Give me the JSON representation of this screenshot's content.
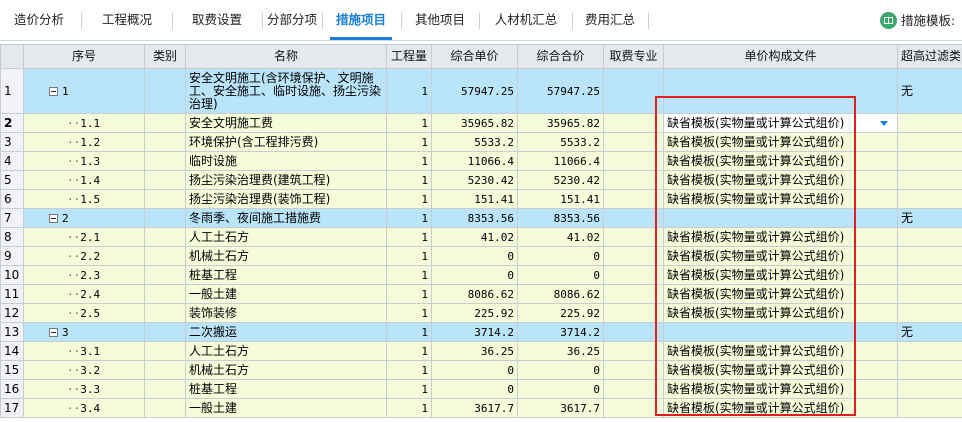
{
  "tabs": [
    {
      "label": "造价分析",
      "active": false
    },
    {
      "label": "工程概况",
      "active": false
    },
    {
      "label": "取费设置",
      "active": false
    },
    {
      "label": "分部分项",
      "active": false
    },
    {
      "label": "措施项目",
      "active": true
    },
    {
      "label": "其他项目",
      "active": false
    },
    {
      "label": "人材机汇总",
      "active": false
    },
    {
      "label": "费用汇总",
      "active": false
    }
  ],
  "template_button": {
    "label": "措施模板:",
    "icon": "template-book-icon"
  },
  "columns": [
    "",
    "序号",
    "类别",
    "名称",
    "工程量",
    "综合单价",
    "综合合价",
    "取费专业",
    "单价构成文件",
    "超高过滤类"
  ],
  "rows": [
    {
      "n": "1",
      "code": "1",
      "name": "安全文明施工(含环境保护、文明施工、安全施工、临时设施、扬尘污染治理)",
      "qty": "1",
      "price": "57947.25",
      "total": "57947.25",
      "file": "",
      "filter": "无",
      "level": "group"
    },
    {
      "n": "2",
      "code": "1.1",
      "name": "安全文明施工费",
      "qty": "1",
      "price": "35965.82",
      "total": "35965.82",
      "file": "缺省模板(实物量或计算公式组价)",
      "filter": "",
      "level": "sub",
      "active": true
    },
    {
      "n": "3",
      "code": "1.2",
      "name": "环境保护(含工程排污费)",
      "qty": "1",
      "price": "5533.2",
      "total": "5533.2",
      "file": "缺省模板(实物量或计算公式组价)",
      "filter": "",
      "level": "sub"
    },
    {
      "n": "4",
      "code": "1.3",
      "name": "临时设施",
      "qty": "1",
      "price": "11066.4",
      "total": "11066.4",
      "file": "缺省模板(实物量或计算公式组价)",
      "filter": "",
      "level": "sub"
    },
    {
      "n": "5",
      "code": "1.4",
      "name": "扬尘污染治理费(建筑工程)",
      "qty": "1",
      "price": "5230.42",
      "total": "5230.42",
      "file": "缺省模板(实物量或计算公式组价)",
      "filter": "",
      "level": "sub"
    },
    {
      "n": "6",
      "code": "1.5",
      "name": "扬尘污染治理费(装饰工程)",
      "qty": "1",
      "price": "151.41",
      "total": "151.41",
      "file": "缺省模板(实物量或计算公式组价)",
      "filter": "",
      "level": "sub"
    },
    {
      "n": "7",
      "code": "2",
      "name": "冬雨季、夜间施工措施费",
      "qty": "1",
      "price": "8353.56",
      "total": "8353.56",
      "file": "",
      "filter": "无",
      "level": "group"
    },
    {
      "n": "8",
      "code": "2.1",
      "name": "人工土石方",
      "qty": "1",
      "price": "41.02",
      "total": "41.02",
      "file": "缺省模板(实物量或计算公式组价)",
      "filter": "",
      "level": "sub"
    },
    {
      "n": "9",
      "code": "2.2",
      "name": "机械土石方",
      "qty": "1",
      "price": "0",
      "total": "0",
      "file": "缺省模板(实物量或计算公式组价)",
      "filter": "",
      "level": "sub"
    },
    {
      "n": "10",
      "code": "2.3",
      "name": "桩基工程",
      "qty": "1",
      "price": "0",
      "total": "0",
      "file": "缺省模板(实物量或计算公式组价)",
      "filter": "",
      "level": "sub"
    },
    {
      "n": "11",
      "code": "2.4",
      "name": "一般土建",
      "qty": "1",
      "price": "8086.62",
      "total": "8086.62",
      "file": "缺省模板(实物量或计算公式组价)",
      "filter": "",
      "level": "sub"
    },
    {
      "n": "12",
      "code": "2.5",
      "name": "装饰装修",
      "qty": "1",
      "price": "225.92",
      "total": "225.92",
      "file": "缺省模板(实物量或计算公式组价)",
      "filter": "",
      "level": "sub"
    },
    {
      "n": "13",
      "code": "3",
      "name": "二次搬运",
      "qty": "1",
      "price": "3714.2",
      "total": "3714.2",
      "file": "",
      "filter": "无",
      "level": "group"
    },
    {
      "n": "14",
      "code": "3.1",
      "name": "人工土石方",
      "qty": "1",
      "price": "36.25",
      "total": "36.25",
      "file": "缺省模板(实物量或计算公式组价)",
      "filter": "",
      "level": "sub"
    },
    {
      "n": "15",
      "code": "3.2",
      "name": "机械土石方",
      "qty": "1",
      "price": "0",
      "total": "0",
      "file": "缺省模板(实物量或计算公式组价)",
      "filter": "",
      "level": "sub"
    },
    {
      "n": "16",
      "code": "3.3",
      "name": "桩基工程",
      "qty": "1",
      "price": "0",
      "total": "0",
      "file": "缺省模板(实物量或计算公式组价)",
      "filter": "",
      "level": "sub"
    },
    {
      "n": "17",
      "code": "3.4",
      "name": "一般土建",
      "qty": "1",
      "price": "3617.7",
      "total": "3617.7",
      "file": "缺省模板(实物量或计算公式组价)",
      "filter": "",
      "level": "sub"
    }
  ]
}
